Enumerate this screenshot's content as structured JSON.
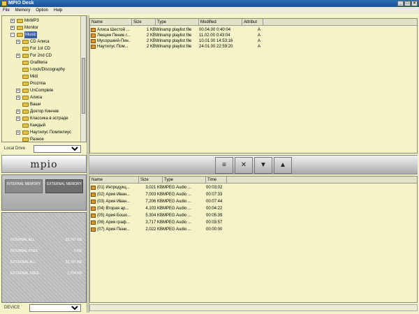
{
  "window": {
    "title": "MPIO Desk"
  },
  "menu": [
    "File",
    "Memory",
    "Option",
    "Help"
  ],
  "tree": {
    "items": [
      {
        "label": "MnMP3",
        "indent": 2,
        "expander": "+"
      },
      {
        "label": "Monitor",
        "indent": 2,
        "expander": "+"
      },
      {
        "label": "Music",
        "indent": 2,
        "expander": "-",
        "selected": true
      },
      {
        "label": "CD Алиса",
        "indent": 3,
        "expander": "+"
      },
      {
        "label": "For 1st CD",
        "indent": 3,
        "expander": ""
      },
      {
        "label": "For 2nd CD",
        "indent": 3,
        "expander": "+"
      },
      {
        "label": "Grafiteria",
        "indent": 3,
        "expander": ""
      },
      {
        "label": "I-rock/Discography",
        "indent": 3,
        "expander": ""
      },
      {
        "label": "Midi",
        "indent": 3,
        "expander": ""
      },
      {
        "label": "Prozrina",
        "indent": 3,
        "expander": ""
      },
      {
        "label": "UnComplete",
        "indent": 3,
        "expander": "+"
      },
      {
        "label": "Алиса",
        "indent": 3,
        "expander": "+"
      },
      {
        "label": "Ваши",
        "indent": 3,
        "expander": ""
      },
      {
        "label": "Доктор Кинчев",
        "indent": 3,
        "expander": "+"
      },
      {
        "label": "Классика в эстраде",
        "indent": 3,
        "expander": "+"
      },
      {
        "label": "Каждый",
        "indent": 3,
        "expander": ""
      },
      {
        "label": "Наутилус Помпилиус",
        "indent": 3,
        "expander": "+"
      },
      {
        "label": "Разное",
        "indent": 3,
        "expander": ""
      }
    ]
  },
  "drive_select": {
    "label": "Local Drive",
    "value": ""
  },
  "logo": "mpio",
  "memory_tabs": {
    "internal": "INTERNAL MEMORY",
    "external": "EXTERNAL MEMORY"
  },
  "stats": [
    {
      "key": "INTERNAL ALL :",
      "value": "33,797 KB"
    },
    {
      "key": "INTERNAL FREE :",
      "value": "0 KB"
    },
    {
      "key": "EXTERNAL ALL :",
      "value": "33,797 KB"
    },
    {
      "key": "EXTERNAL FREE :",
      "value": "1,764 KB"
    }
  ],
  "bottom_drive": {
    "label": "DEVICE",
    "value": ""
  },
  "pc_list": {
    "headers": [
      "Name",
      "Size",
      "Type",
      "Modified",
      "Attribut"
    ],
    "rows": [
      {
        "name": "Алиса Шестой ...",
        "size": "1 KB",
        "type": "Winamp playlist file",
        "modified": "00.04.00 0:40:04",
        "attr": "A"
      },
      {
        "name": "Лекции Пение г...",
        "size": "2 KB",
        "type": "Winamp playlist file",
        "modified": "11.02.00 0:43:04",
        "attr": "A"
      },
      {
        "name": "Мусоршкий-Пин...",
        "size": "2 KB",
        "type": "Winamp playlist file",
        "modified": "10.01.00 14:53:16",
        "attr": "A"
      },
      {
        "name": "Наутилус Пом...",
        "size": "2 KB",
        "type": "Winamp playlist file",
        "modified": "24.01.00 22:59:20",
        "attr": "A"
      }
    ]
  },
  "toolbar": {
    "btn1": "≡",
    "btn2": "✕",
    "btn3": "▼",
    "btn4": "▲"
  },
  "mp_list": {
    "headers": [
      "Name",
      "Size",
      "Type",
      "Time"
    ],
    "rows": [
      {
        "name": "(01) Интродукц...",
        "size": "3,021 KB",
        "type": "MPEG Audio ...",
        "time": "00:03:02"
      },
      {
        "name": "(02) Ария Иван...",
        "size": "7,003 KB",
        "type": "MPEG Audio ...",
        "time": "00:07:33"
      },
      {
        "name": "(03) Ария Иван...",
        "size": "7,206 KB",
        "type": "MPEG Audio ...",
        "time": "00:07:44"
      },
      {
        "name": "(04) Вторая ар...",
        "size": "4,103 KB",
        "type": "MPEG Audio ...",
        "time": "00:04:22"
      },
      {
        "name": "(05) Ария Бошо...",
        "size": "5,304 KB",
        "type": "MPEG Audio ...",
        "time": "00:05:39"
      },
      {
        "name": "(06) Ария граф...",
        "size": "3,717 KB",
        "type": "MPEG Audio ...",
        "time": "00:03:57"
      },
      {
        "name": "(07) Ария Пени...",
        "size": "2,022 KB",
        "type": "MPEG Audio ...",
        "time": "00:00:00"
      }
    ]
  }
}
